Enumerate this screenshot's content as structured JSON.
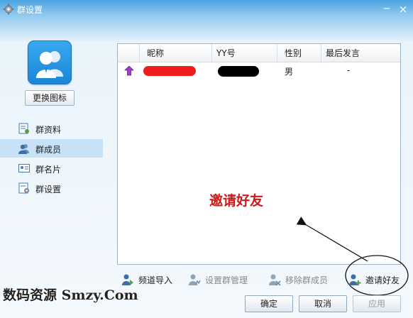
{
  "window": {
    "title": "群设置",
    "minimize_glyph": "−",
    "close_glyph": "×"
  },
  "sidebar": {
    "change_icon_label": "更换图标",
    "items": [
      {
        "label": "群资料",
        "icon": "group-info-icon",
        "active": false
      },
      {
        "label": "群成员",
        "icon": "group-members-icon",
        "active": true
      },
      {
        "label": "群名片",
        "icon": "group-card-icon",
        "active": false
      },
      {
        "label": "群设置",
        "icon": "group-settings-icon",
        "active": false
      }
    ]
  },
  "members_table": {
    "columns": [
      "昵称",
      "YY号",
      "性别",
      "最后发言"
    ],
    "rows": [
      {
        "nickname": "",
        "yy_id": "",
        "gender": "男",
        "last_message": "-"
      }
    ]
  },
  "annotation": {
    "text": "邀请好友",
    "color": "#d01818"
  },
  "toolbar": {
    "import_channel": "频道导入",
    "set_admin": "设置群管理",
    "remove_member": "移除群成员",
    "invite_friend": "邀请好友"
  },
  "footer": {
    "ok": "确定",
    "cancel": "取消",
    "apply": "应用"
  },
  "watermark": "数码资源 Smzy.Com",
  "colors": {
    "accent": "#2a8fd8",
    "active_nav": "#c7e1f6",
    "redaction_red": "#ee1c1c"
  }
}
